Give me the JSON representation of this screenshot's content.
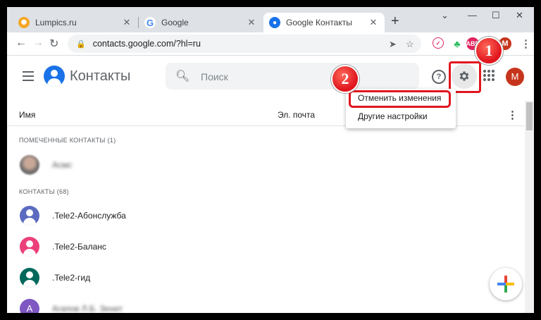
{
  "browser": {
    "tabs": [
      {
        "title": "Lumpics.ru",
        "favicon": "orange-circle"
      },
      {
        "title": "Google",
        "favicon": "google-g"
      },
      {
        "title": "Google Контакты",
        "favicon": "contacts-person",
        "active": true
      }
    ],
    "url": "contacts.google.com/?hl=ru",
    "profile_initial": "M",
    "ext_abp": "ABP"
  },
  "app": {
    "title": "Контакты",
    "search_placeholder": "Поиск",
    "avatar_initial": "M"
  },
  "columns": {
    "name": "Имя",
    "email": "Эл. почта"
  },
  "sections": {
    "starred": "ПОМЕЧЕННЫЕ КОНТАКТЫ (1)",
    "contacts": "КОНТАКТЫ (68)"
  },
  "starred_contacts": [
    {
      "name": "Асмс"
    }
  ],
  "contacts": [
    {
      "name": ".Tele2-Абонслужба",
      "color": "#5c6bc0"
    },
    {
      "name": ".Tele2-Баланс",
      "color": "#ec407a"
    },
    {
      "name": ".Tele2-гид",
      "color": "#00695c"
    },
    {
      "name": "Агапов Л.Б. Зенит",
      "color": "#7e57c2",
      "initial": "А"
    }
  ],
  "menu": {
    "items": [
      "Отменить изменения",
      "Другие настройки"
    ]
  },
  "annotations": {
    "step1": "1",
    "step2": "2"
  }
}
